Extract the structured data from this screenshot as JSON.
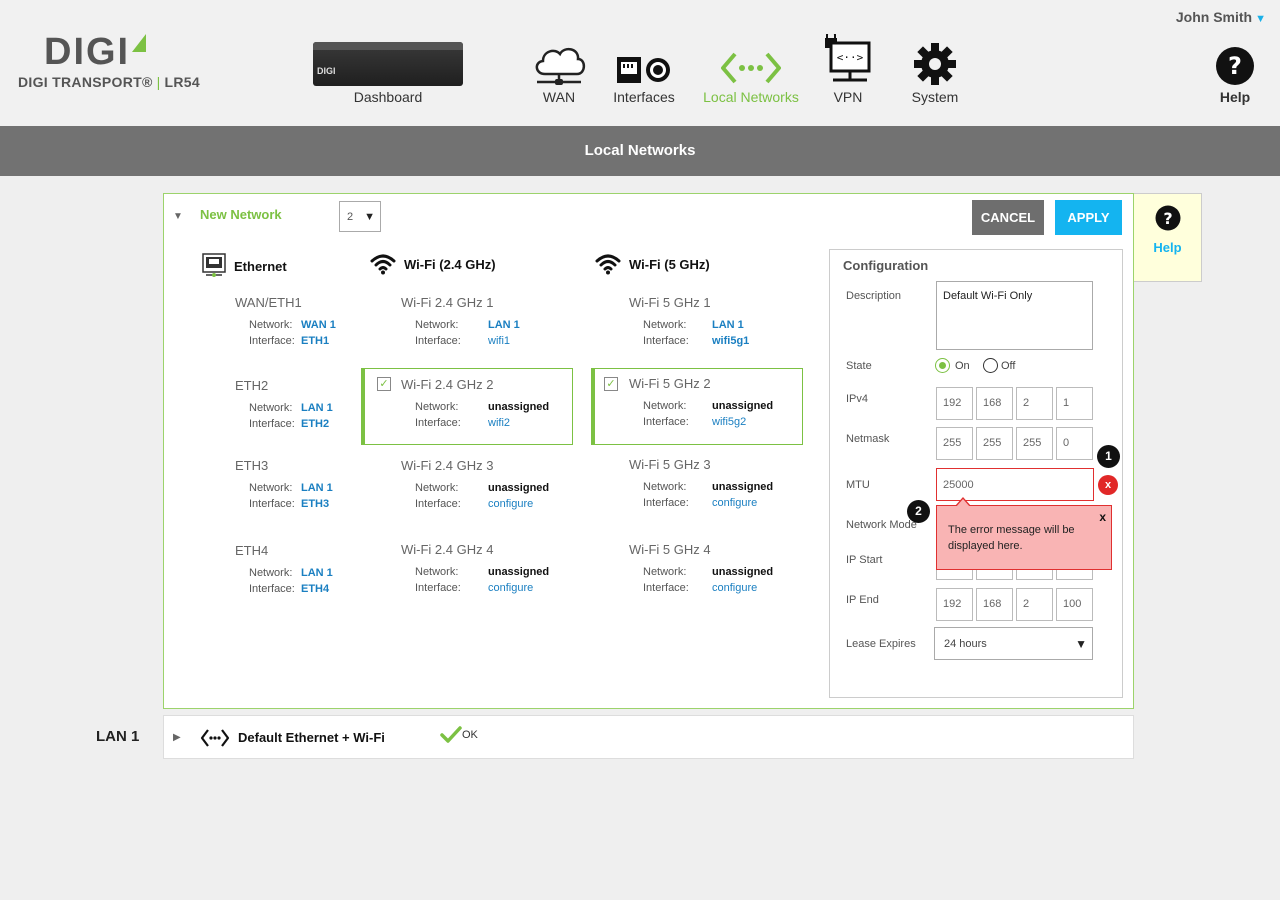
{
  "header": {
    "user": "John Smith",
    "brand": "DIGI",
    "product": "DIGI TRANSPORT®",
    "model": "LR54",
    "device_text": "DIGI",
    "nav": {
      "dashboard": "Dashboard",
      "wan": "WAN",
      "interfaces": "Interfaces",
      "local": "Local Networks",
      "vpn": "VPN",
      "system": "System",
      "help": "Help"
    }
  },
  "page_title": "Local Networks",
  "panel": {
    "title": "New Network",
    "select_value": "2",
    "cancel": "CANCEL",
    "apply": "APPLY",
    "columns": {
      "ethernet": "Ethernet",
      "wifi24": "Wi-Fi (2.4 GHz)",
      "wifi5": "Wi-Fi (5 GHz)"
    },
    "labels": {
      "network": "Network:",
      "interface": "Interface:"
    },
    "ethernet": [
      {
        "name": "WAN/ETH1",
        "network": "WAN 1",
        "interface": "ETH1"
      },
      {
        "name": "ETH2",
        "network": "LAN 1",
        "interface": "ETH2"
      },
      {
        "name": "ETH3",
        "network": "LAN 1",
        "interface": "ETH3"
      },
      {
        "name": "ETH4",
        "network": "LAN 1",
        "interface": "ETH4"
      }
    ],
    "wifi24": [
      {
        "name": "Wi-Fi 2.4 GHz 1",
        "network": "LAN 1",
        "interface": "wifi1"
      },
      {
        "name": "Wi-Fi 2.4 GHz 2",
        "network": "unassigned",
        "interface": "wifi2"
      },
      {
        "name": "Wi-Fi 2.4 GHz  3",
        "network": "unassigned",
        "interface": "configure"
      },
      {
        "name": "Wi-Fi 2.4 GHz  4",
        "network": "unassigned",
        "interface": "configure"
      }
    ],
    "wifi5": [
      {
        "name": "Wi-Fi 5 GHz 1",
        "network": "LAN 1",
        "interface": "wifi5g1"
      },
      {
        "name": "Wi-Fi 5 GHz 2",
        "network": "unassigned",
        "interface": "wifi5g2"
      },
      {
        "name": "Wi-Fi 5 GHz  3",
        "network": "unassigned",
        "interface": "configure"
      },
      {
        "name": "Wi-Fi 5 GHz  4",
        "network": "unassigned",
        "interface": "configure"
      }
    ]
  },
  "config": {
    "title": "Configuration",
    "description_label": "Description",
    "description_value": "Default Wi-Fi Only",
    "state_label": "State",
    "state_on": "On",
    "state_off": "Off",
    "ipv4_label": "IPv4",
    "ipv4": [
      "192",
      "168",
      "2",
      "1"
    ],
    "netmask_label": "Netmask",
    "netmask": [
      "255",
      "255",
      "255",
      "0"
    ],
    "mtu_label": "MTU",
    "mtu_value": "25000",
    "error_icon": "x",
    "badge1": "1",
    "badge2": "2",
    "network_mode_label": "Network Mode",
    "ip_start_label": "IP Start",
    "ip_end_label": "IP End",
    "ip_end": [
      "192",
      "168",
      "2",
      "100"
    ],
    "lease_label": "Lease Expires",
    "lease_value": "24 hours",
    "error_message": "The error message will be displayed here.",
    "error_close": "x"
  },
  "help_side": {
    "label": "Help"
  },
  "lan": {
    "label": "LAN 1",
    "name": "Default Ethernet + Wi-Fi",
    "status": "OK"
  },
  "colors": {
    "accent": "#7cc143",
    "primary": "#14b4f0",
    "error": "#e03030"
  }
}
